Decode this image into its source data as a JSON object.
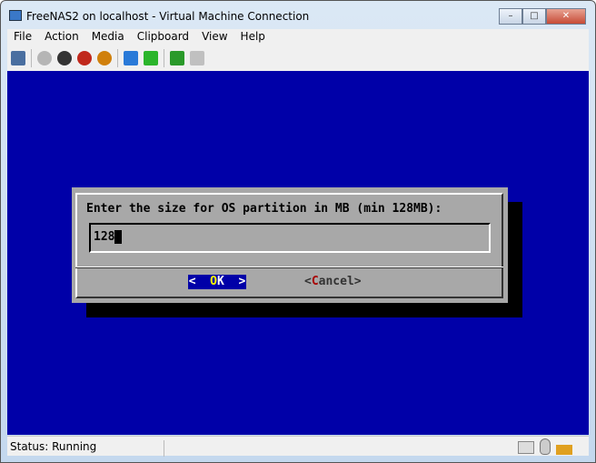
{
  "window": {
    "title": "FreeNAS2 on localhost - Virtual Machine Connection",
    "minimize": "–",
    "maximize": "□",
    "close": "✕"
  },
  "menu": [
    "File",
    "Action",
    "Media",
    "Clipboard",
    "View",
    "Help"
  ],
  "toolbar": [
    {
      "icon": "ctrl-alt-del-icon",
      "color": "#4a6fa0"
    },
    {
      "icon": "start-icon",
      "color": "#b5b5b5"
    },
    {
      "icon": "turn-off-icon",
      "color": "#333333"
    },
    {
      "icon": "shutdown-icon",
      "color": "#c0281c"
    },
    {
      "icon": "save-icon",
      "color": "#d0800c"
    },
    {
      "icon": "pause-icon",
      "color": "#2a7ad8"
    },
    {
      "icon": "reset-icon",
      "color": "#2bb52b"
    },
    {
      "icon": "snapshot-icon",
      "color": "#2a9a2a"
    },
    {
      "icon": "revert-icon",
      "color": "#c0c0c0"
    }
  ],
  "dialog": {
    "prompt": "Enter the size for OS partition in MB (min 128MB):",
    "value": "128",
    "ok_left": "<  ",
    "ok_hotkey": "O",
    "ok_rest": "K  >",
    "cancel_left": "<",
    "cancel_hotkey": "C",
    "cancel_rest": "ancel>"
  },
  "status": {
    "text": "Status: Running"
  }
}
